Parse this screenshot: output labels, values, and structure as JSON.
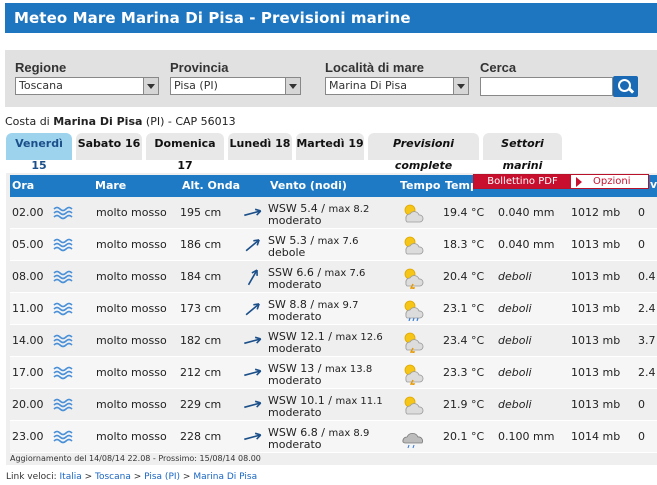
{
  "header": {
    "title": "Meteo Mare Marina Di Pisa - Previsioni marine"
  },
  "search": {
    "regione_label": "Regione",
    "regione_value": "Toscana",
    "provincia_label": "Provincia",
    "provincia_value": "Pisa (PI)",
    "localita_label": "Località di mare",
    "localita_value": "Marina Di Pisa",
    "cerca_label": "Cerca",
    "cerca_value": ""
  },
  "coast": {
    "prefix": "Costa di",
    "place": "Marina Di Pisa",
    "suffix": "(PI) - CAP 56013"
  },
  "tabs": [
    "Venerdì 15",
    "Sabato 16",
    "Domenica 17",
    "Lunedì 18",
    "Martedì 19",
    "Previsioni complete",
    "Settori marini"
  ],
  "overlay": {
    "pdf": "Bollettino PDF",
    "options": "Opzioni"
  },
  "table": {
    "headers": [
      "Ora",
      "Mare",
      "Alt. Onda",
      "Vento (nodi)",
      "Tempo",
      "Temp"
    ],
    "edge_header": "v",
    "rows": [
      {
        "ora": "02.00",
        "mare": "molto mosso",
        "onda": "195 cm",
        "dir": "WSW",
        "vel": "5.4",
        "max": "max 8.2",
        "desc": "moderato",
        "icon": "sun-cloud-icon",
        "temp": "19.4 °C",
        "prec": "0.040 mm",
        "press": "1012 mb",
        "extra": "0"
      },
      {
        "ora": "05.00",
        "mare": "molto mosso",
        "onda": "186 cm",
        "dir": "SW",
        "vel": "5.3",
        "max": "max 7.6",
        "desc": "debole",
        "icon": "sun-cloud-icon",
        "temp": "18.3 °C",
        "prec": "0.040 mm",
        "press": "1013 mb",
        "extra": "0"
      },
      {
        "ora": "08.00",
        "mare": "molto mosso",
        "onda": "184 cm",
        "dir": "SSW",
        "vel": "6.6",
        "max": "max 7.6",
        "desc": "moderato",
        "icon": "thunder-sun-icon",
        "temp": "20.4 °C",
        "prec": "deboli",
        "press": "1013 mb",
        "extra": "0.4"
      },
      {
        "ora": "11.00",
        "mare": "molto mosso",
        "onda": "173 cm",
        "dir": "SW",
        "vel": "8.8",
        "max": "max 9.7",
        "desc": "moderato",
        "icon": "sun-rain-icon",
        "temp": "23.1 °C",
        "prec": "deboli",
        "press": "1013 mb",
        "extra": "2.4"
      },
      {
        "ora": "14.00",
        "mare": "molto mosso",
        "onda": "182 cm",
        "dir": "WSW",
        "vel": "12.1",
        "max": "max 12.6",
        "desc": "moderato",
        "icon": "thunder-sun-icon",
        "temp": "23.4 °C",
        "prec": "deboli",
        "press": "1013 mb",
        "extra": "3.7"
      },
      {
        "ora": "17.00",
        "mare": "molto mosso",
        "onda": "212 cm",
        "dir": "WSW",
        "vel": "13",
        "max": "max 13.8",
        "desc": "moderato",
        "icon": "thunder-sun-icon",
        "temp": "23.3 °C",
        "prec": "deboli",
        "press": "1013 mb",
        "extra": "2.4"
      },
      {
        "ora": "20.00",
        "mare": "molto mosso",
        "onda": "229 cm",
        "dir": "WSW",
        "vel": "10.1",
        "max": "max 11.1",
        "desc": "moderato",
        "icon": "sun-cloud-icon",
        "temp": "21.9 °C",
        "prec": "deboli",
        "press": "1013 mb",
        "extra": "0"
      },
      {
        "ora": "23.00",
        "mare": "molto mosso",
        "onda": "228 cm",
        "dir": "WSW",
        "vel": "6.8",
        "max": "max 8.9",
        "desc": "moderato",
        "icon": "cloud-drizzle-icon",
        "temp": "20.1 °C",
        "prec": "0.100 mm",
        "press": "1014 mb",
        "extra": "0"
      }
    ]
  },
  "footnote": "Aggiornamento del 14/08/14 22.08 - Prossimo: 15/08/14 08.00",
  "links": {
    "label": "Link veloci:",
    "items": [
      "Italia",
      "Toscana",
      "Pisa (PI)",
      "Marina Di Pisa"
    ]
  },
  "colors": {
    "header": "#1f76c0",
    "table_header": "#1e7ac4",
    "tab_active": "#9ed3ee",
    "accent_red": "#c8102e"
  }
}
